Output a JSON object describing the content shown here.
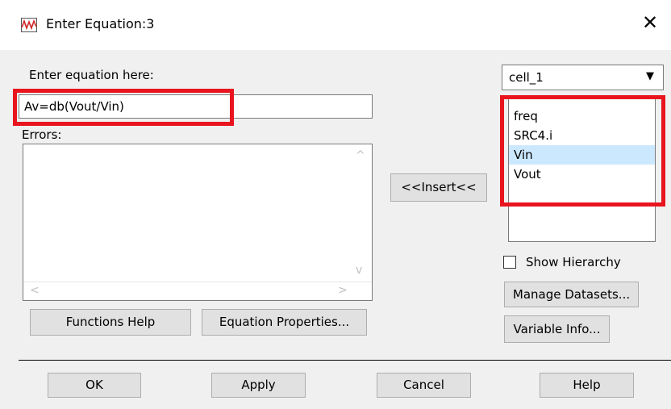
{
  "window": {
    "title": "Enter Equation:3",
    "close_glyph": "✕"
  },
  "equation": {
    "label": "Enter equation here:",
    "value": "Av=db(Vout/Vin)"
  },
  "errors": {
    "label": "Errors:",
    "up_arrow": "^",
    "down_arrow": "v",
    "left_arrow": "<",
    "right_arrow": ">"
  },
  "insert_button": "<<Insert<<",
  "dataset": {
    "selected": "cell_1",
    "arrow": "▼"
  },
  "variables": [
    {
      "label": "freq",
      "selected": false
    },
    {
      "label": "SRC4.i",
      "selected": false
    },
    {
      "label": "Vin",
      "selected": true
    },
    {
      "label": "Vout",
      "selected": false
    }
  ],
  "show_hierarchy": {
    "label": "Show Hierarchy",
    "checked": false
  },
  "buttons": {
    "manage_datasets": "Manage Datasets...",
    "variable_info": "Variable Info...",
    "functions_help": "Functions Help",
    "equation_properties": "Equation Properties...",
    "ok": "OK",
    "apply": "Apply",
    "cancel": "Cancel",
    "help": "Help"
  },
  "colors": {
    "highlight": "#e8141e",
    "selection": "#cce8ff"
  }
}
